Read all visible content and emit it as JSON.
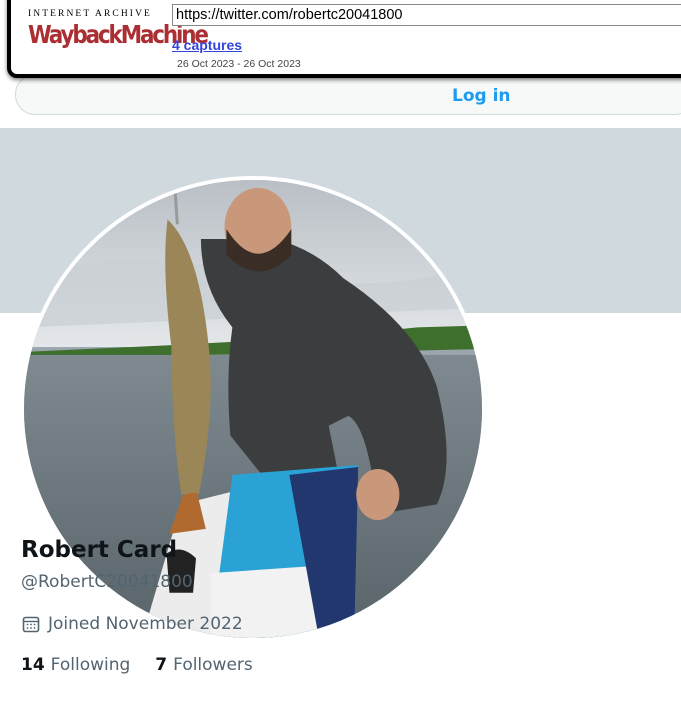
{
  "wayback": {
    "logo_top": "INTERNET ARCHIVE",
    "logo_main": "WaybackMachine",
    "url": "https://twitter.com/robertc20041800",
    "captures": "4 captures",
    "dates": "26 Oct 2023 - 26 Oct 2023"
  },
  "header": {
    "login": "Log in"
  },
  "profile": {
    "name": "Robert Card",
    "handle": "@RobertC20041800",
    "joined": "Joined November 2022",
    "following_count": "14",
    "following_label": "Following",
    "followers_count": "7",
    "followers_label": "Followers"
  },
  "colors": {
    "link": "#1d9bf0",
    "banner": "#cfd9de",
    "wayback_red": "#ab2e33",
    "captures_link": "#3344dd"
  },
  "icons": {
    "joined": "calendar-icon"
  }
}
